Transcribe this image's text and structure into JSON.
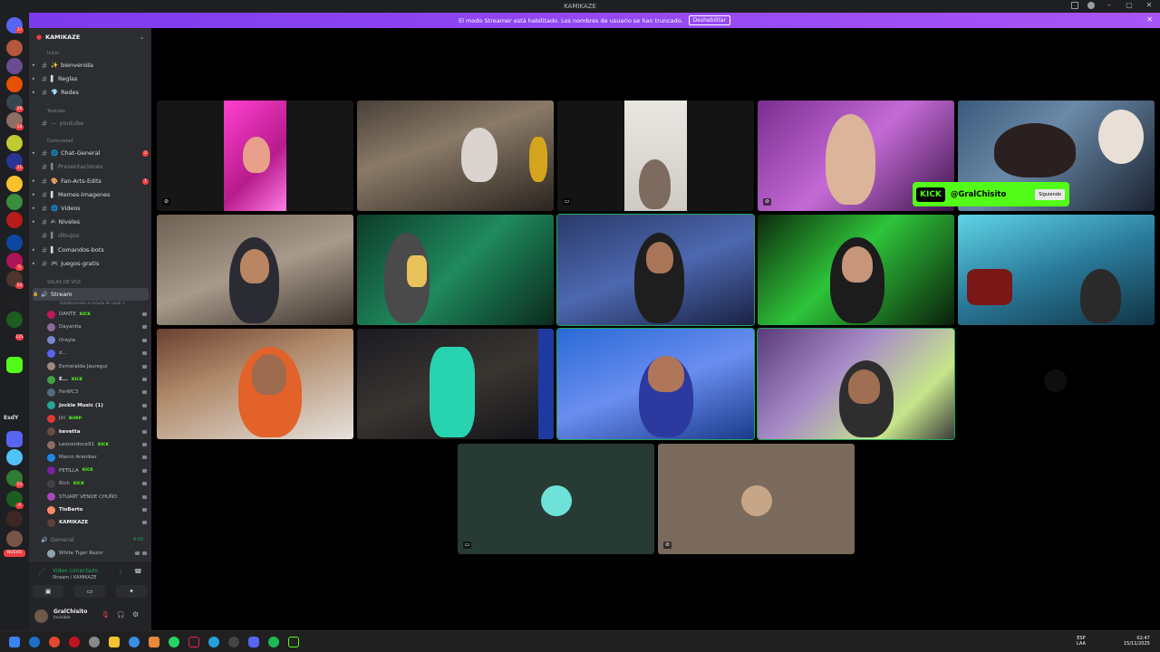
{
  "window": {
    "title": "KAMIKAZE"
  },
  "banner": {
    "text": "El modo Streamer está habilitado. Los nombres de usuario se han truncado.",
    "button": "Deshabilitar"
  },
  "rail": {
    "badges": [
      "37",
      "26",
      "14",
      "31",
      "5",
      "53",
      "121",
      "53",
      "4"
    ],
    "text_server": "EsdY",
    "nuevo": "NUEVO"
  },
  "guild": {
    "name": "KAMIKAZE"
  },
  "categories": {
    "inicio": "Inicio",
    "youtube": "Youtube",
    "comunidad": "Comunidad",
    "voz": "SALAS DE VOZ"
  },
  "channels": [
    {
      "label": "bienvenida",
      "prefix": "✨",
      "dim": false,
      "badge": ""
    },
    {
      "label": "Reglas",
      "prefix": "▌",
      "dim": false,
      "badge": ""
    },
    {
      "label": "Redes",
      "prefix": "💎",
      "dim": false,
      "badge": ""
    },
    {
      "label": "youtube",
      "prefix": "—",
      "dim": true,
      "badge": ""
    },
    {
      "label": "Chat-General",
      "prefix": "🌐",
      "dim": false,
      "badge": "2"
    },
    {
      "label": "Presentaciones",
      "prefix": "▌",
      "dim": true,
      "badge": ""
    },
    {
      "label": "Fan-Arts-Edits",
      "prefix": "🎨",
      "dim": false,
      "badge": "1"
    },
    {
      "label": "Memes-Imagenes",
      "prefix": "▌",
      "dim": false,
      "badge": ""
    },
    {
      "label": "Videos",
      "prefix": "🌐",
      "dim": false,
      "badge": ""
    },
    {
      "label": "Niveles",
      "prefix": "✍",
      "dim": false,
      "badge": ""
    },
    {
      "label": "dibujos",
      "prefix": "▌",
      "dim": true,
      "badge": ""
    },
    {
      "label": "Comandos-bots",
      "prefix": "▌",
      "dim": false,
      "badge": ""
    },
    {
      "label": "juegos-gratis",
      "prefix": "🎮",
      "dim": false,
      "badge": ""
    }
  ],
  "voice_channel": {
    "label": "Stream",
    "sub": "Estableciendo un estado de canal ✎"
  },
  "voice_users": [
    {
      "name": "DANTE",
      "kick": "KICK",
      "color": "#c2185b",
      "bright": false
    },
    {
      "name": "Dayanita",
      "kick": "",
      "color": "#8e6b9f",
      "bright": false
    },
    {
      "name": "Orayla",
      "kick": "",
      "color": "#7986cb",
      "bright": false
    },
    {
      "name": "d...",
      "kick": "",
      "color": "#5865f2",
      "bright": false
    },
    {
      "name": "Esmeralda Jauregui",
      "kick": "",
      "color": "#a1887f",
      "bright": false
    },
    {
      "name": "E...",
      "kick": "KICK",
      "color": "#43a047",
      "bright": true
    },
    {
      "name": "FerWC3",
      "kick": "",
      "color": "#546e7a",
      "bright": false
    },
    {
      "name": "Jockie Music (1)",
      "kick": "",
      "color": "#26a69a",
      "bright": true
    },
    {
      "name": "JVI",
      "kick": "BURP",
      "color": "#e53935",
      "bright": false
    },
    {
      "name": "kevetta",
      "kick": "",
      "color": "#6d4c41",
      "bright": true
    },
    {
      "name": "Leonerdoce91",
      "kick": "KICK",
      "color": "#8d6e63",
      "bright": false
    },
    {
      "name": "Marco Aranibar",
      "kick": "",
      "color": "#1e88e5",
      "bright": false
    },
    {
      "name": "PETILLA",
      "kick": "KICK",
      "color": "#7b1fa2",
      "bright": false
    },
    {
      "name": "Rich",
      "kick": "KICK",
      "color": "#424242",
      "bright": false
    },
    {
      "name": "STUART VENDE CHUÑO",
      "kick": "",
      "color": "#ab47bc",
      "bright": false
    },
    {
      "name": "TioBerto",
      "kick": "",
      "color": "#ff8a65",
      "bright": true
    },
    {
      "name": "KAMIKAZE",
      "kick": "",
      "color": "#5d4037",
      "bright": true
    }
  ],
  "other_voice": [
    {
      "label": "General",
      "count": "4:09"
    },
    {
      "label": "White Tiger Razor",
      "count": ""
    }
  ],
  "connection": {
    "status": "Video conectado",
    "sub": "Stream / KAMIKAZE"
  },
  "user": {
    "name": "GralChisito",
    "status": "Invisible"
  },
  "kick_overlay": {
    "logo": "KICK",
    "user": "@GralChisito",
    "follow": "Siguiendo"
  },
  "taskbar": {
    "lang1": "ESP",
    "lang2": "LAA",
    "time": "02:47",
    "date": "15/11/2025"
  }
}
